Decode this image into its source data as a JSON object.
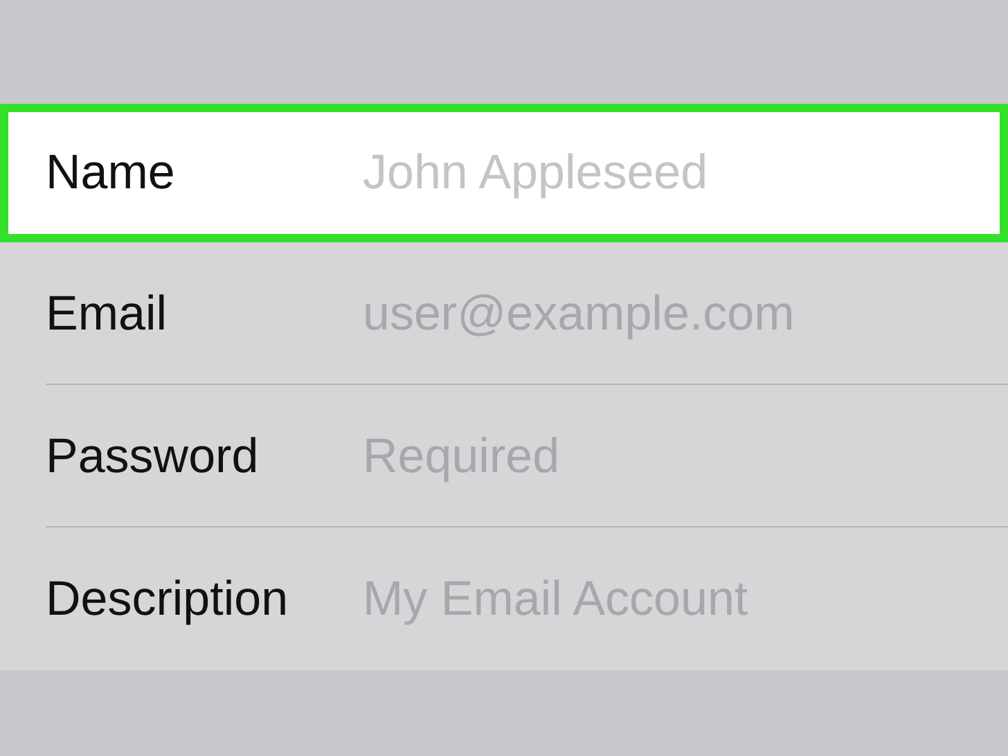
{
  "fields": [
    {
      "label": "Name",
      "placeholder": "John Appleseed",
      "selected": true
    },
    {
      "label": "Email",
      "placeholder": "user@example.com",
      "selected": false
    },
    {
      "label": "Password",
      "placeholder": "Required",
      "selected": false
    },
    {
      "label": "Description",
      "placeholder": "My Email Account",
      "selected": false
    }
  ]
}
